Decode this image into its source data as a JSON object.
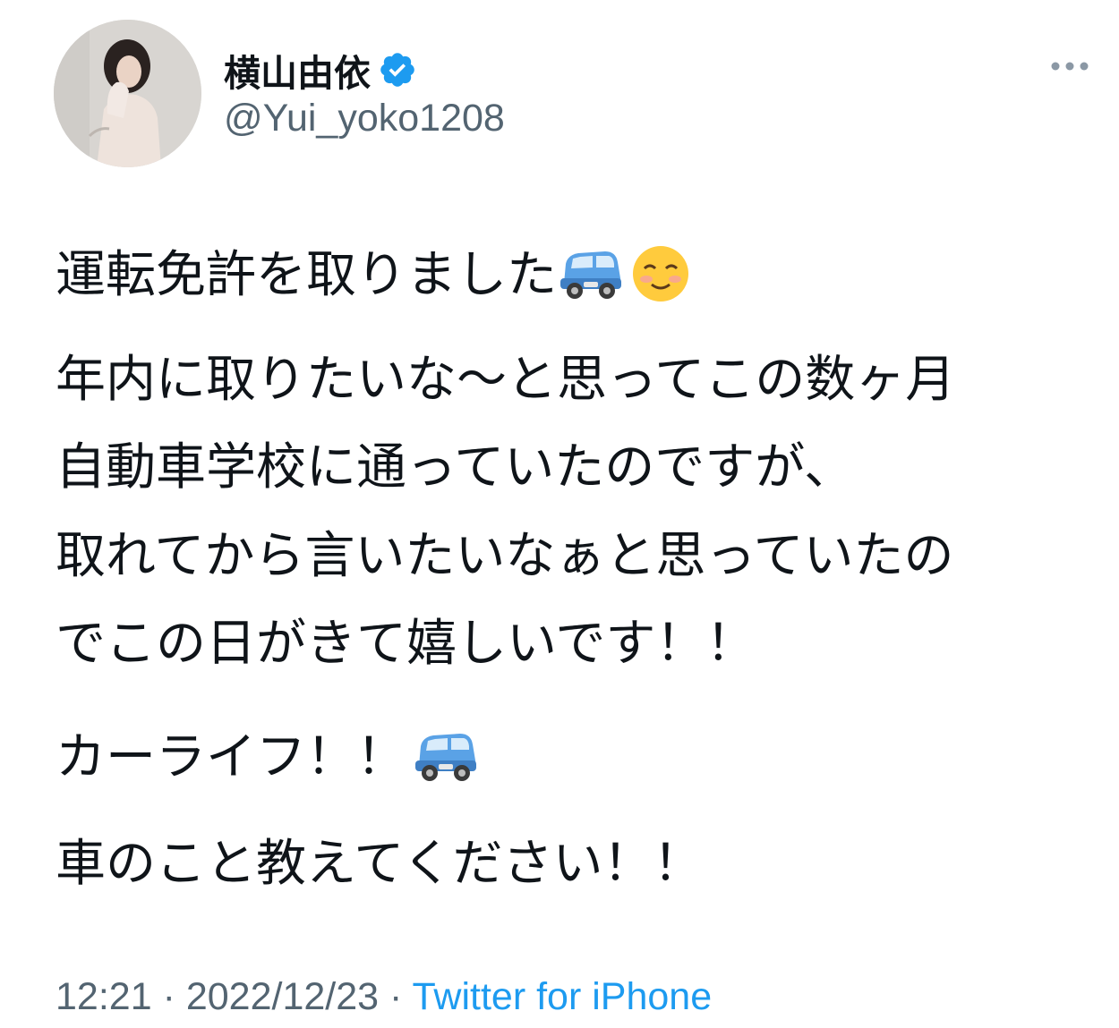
{
  "author": {
    "display_name": "横山由依",
    "handle": "@Yui_yoko1208",
    "verified": true,
    "avatar_icon": "profile-photo"
  },
  "menu": {
    "icon": "more-horizontal-icon"
  },
  "tweet": {
    "lines": [
      "運転免許を取りました",
      "年内に取りたいな〜と思ってこの数ヶ月",
      "自動車学校に通っていたのですが、",
      "取れてから言いたいなぁと思っていたの",
      "でこの日がきて嬉しいです！！",
      "カーライフ！！",
      "車のこと教えてください！！"
    ],
    "emojis": {
      "car": "blue-car-icon",
      "smile": "smiling-face-icon"
    }
  },
  "meta": {
    "time": "12:21",
    "separator": "·",
    "date": "2022/12/23",
    "source": "Twitter for iPhone"
  },
  "colors": {
    "text": "#0f1419",
    "secondary": "#536471",
    "link": "#1d9bf0",
    "verified": "#1d9bf0"
  }
}
